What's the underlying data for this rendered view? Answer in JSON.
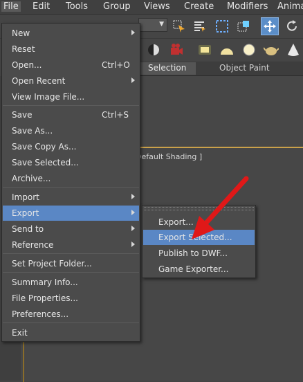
{
  "menubar": {
    "items": [
      "File",
      "Edit",
      "Tools",
      "Group",
      "Views",
      "Create",
      "Modifiers",
      "Animati"
    ],
    "active_index": 0
  },
  "ribbon_tabs": [
    "Selection",
    "Object Paint"
  ],
  "viewport": {
    "label": "Default Shading ]",
    "frame_color": "#caa14a"
  },
  "file_menu": {
    "items": [
      {
        "label": "New",
        "shortcut": "",
        "submenu": true
      },
      {
        "label": "Reset",
        "shortcut": "",
        "submenu": false
      },
      {
        "label": "Open...",
        "shortcut": "Ctrl+O",
        "submenu": false
      },
      {
        "label": "Open Recent",
        "shortcut": "",
        "submenu": true
      },
      {
        "label": "View Image File...",
        "shortcut": "",
        "submenu": false
      },
      {
        "label": "Save",
        "shortcut": "Ctrl+S",
        "submenu": false
      },
      {
        "label": "Save As...",
        "shortcut": "",
        "submenu": false
      },
      {
        "label": "Save Copy As...",
        "shortcut": "",
        "submenu": false
      },
      {
        "label": "Save Selected...",
        "shortcut": "",
        "submenu": false
      },
      {
        "label": "Archive...",
        "shortcut": "",
        "submenu": false
      },
      {
        "label": "Import",
        "shortcut": "",
        "submenu": true
      },
      {
        "label": "Export",
        "shortcut": "",
        "submenu": true,
        "highlighted": true
      },
      {
        "label": "Send to",
        "shortcut": "",
        "submenu": true
      },
      {
        "label": "Reference",
        "shortcut": "",
        "submenu": true
      },
      {
        "label": "Set Project Folder...",
        "shortcut": "",
        "submenu": false
      },
      {
        "label": "Summary Info...",
        "shortcut": "",
        "submenu": false
      },
      {
        "label": "File Properties...",
        "shortcut": "",
        "submenu": false
      },
      {
        "label": "Preferences...",
        "shortcut": "",
        "submenu": false
      },
      {
        "label": "Exit",
        "shortcut": "",
        "submenu": false
      }
    ]
  },
  "export_submenu": {
    "items": [
      {
        "label": "Export..."
      },
      {
        "label": "Export Selected...",
        "highlighted": true
      },
      {
        "label": "Publish to DWF..."
      },
      {
        "label": "Game Exporter..."
      }
    ]
  },
  "colors": {
    "highlight": "#5a87c5",
    "annotation_arrow": "#e01818",
    "menu_bg": "#4b4b4b"
  },
  "icons": [
    "select-object-icon",
    "select-by-name-icon",
    "rect-selection-icon",
    "window-crossing-icon",
    "move-icon",
    "rotate-icon",
    "teapot-render-icon",
    "render-camera-icon",
    "light-icon",
    "sphere-icon",
    "teapot-icon",
    "cone-icon"
  ]
}
